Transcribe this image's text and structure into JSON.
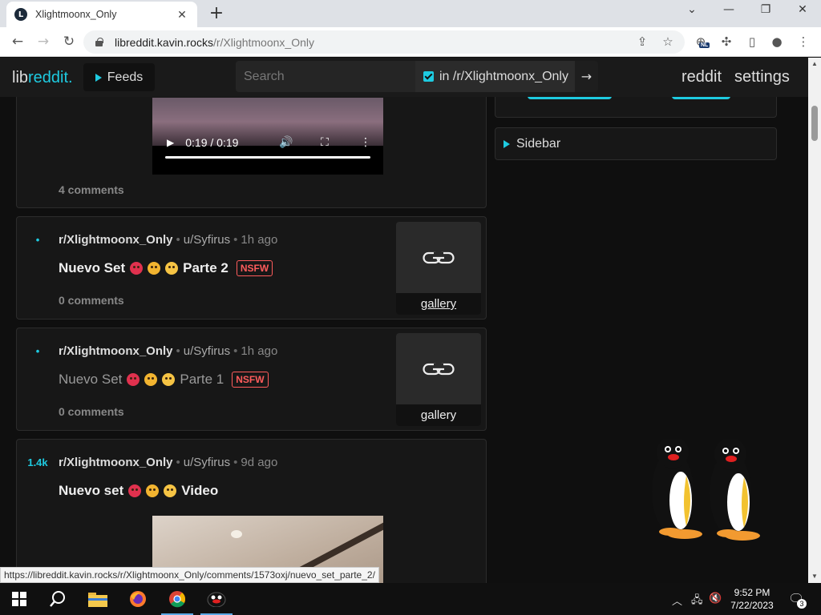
{
  "browser": {
    "tab_title": "Xlightmoonx_Only",
    "tab_favicon_letter": "L",
    "url_host": "libreddit.kavin.rocks",
    "url_path": "/r/Xlightmoonx_Only",
    "ext_badge": "NL",
    "status_url": "https://libreddit.kavin.rocks/r/Xlightmoonx_Only/comments/1573oxj/nuevo_set_parte_2/"
  },
  "nav": {
    "logo_part1": "lib",
    "logo_part2": "reddit.",
    "feeds_label": "Feeds",
    "search_placeholder": "Search",
    "restrict_label": "in /r/Xlightmoonx_Only",
    "search_go": "→",
    "reddit_link": "reddit",
    "settings_link": "settings"
  },
  "video_top": {
    "time": "0:19 / 0:19"
  },
  "posts": [
    {
      "comments": "4 comments"
    },
    {
      "score": "•",
      "subreddit": "r/Xlightmoonx_Only",
      "user": "u/Syfirus",
      "time": "1h ago",
      "title_lead": "Nuevo Set",
      "title_tail": "Parte 2",
      "nsfw": "NSFW",
      "comments": "0 comments",
      "thumb_label": "gallery"
    },
    {
      "score": "•",
      "subreddit": "r/Xlightmoonx_Only",
      "user": "u/Syfirus",
      "time": "1h ago",
      "title_lead": "Nuevo Set",
      "title_tail": "Parte 1",
      "nsfw": "NSFW",
      "comments": "0 comments",
      "thumb_label": "gallery"
    },
    {
      "score": "1.4k",
      "subreddit": "r/Xlightmoonx_Only",
      "user": "u/Syfirus",
      "time": "9d ago",
      "title_lead": "Nuevo set",
      "title_tail": "Video"
    }
  ],
  "sidebar": {
    "label": "Sidebar"
  },
  "taskbar": {
    "time": "9:52 PM",
    "date": "7/22/2023",
    "notif_count": "3"
  },
  "colors": {
    "accent": "#1ecbe1",
    "nsfw": "#ff5c5c",
    "background": "#0f0f0f",
    "card": "#171717"
  }
}
